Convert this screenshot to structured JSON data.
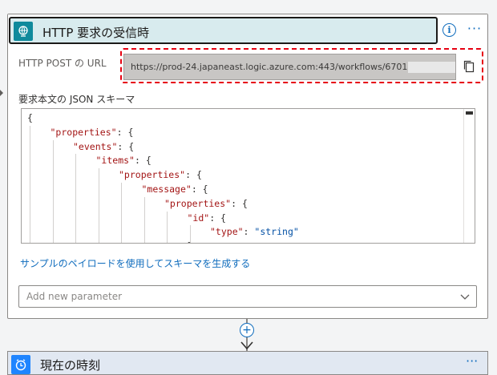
{
  "trigger": {
    "title": "HTTP 要求の受信時",
    "url_label": "HTTP POST の URL",
    "url_value": "https://prod-24.japaneast.logic.azure.com:443/workflows/6701",
    "schema_label": "要求本文の JSON スキーマ",
    "schema_lines": [
      {
        "indent": 0,
        "parts": [
          {
            "t": "{",
            "c": "p"
          }
        ]
      },
      {
        "indent": 1,
        "parts": [
          {
            "t": "\"properties\"",
            "c": "k"
          },
          {
            "t": ": {",
            "c": "p"
          }
        ]
      },
      {
        "indent": 2,
        "parts": [
          {
            "t": "\"events\"",
            "c": "k"
          },
          {
            "t": ": {",
            "c": "p"
          }
        ]
      },
      {
        "indent": 3,
        "parts": [
          {
            "t": "\"items\"",
            "c": "k"
          },
          {
            "t": ": {",
            "c": "p"
          }
        ]
      },
      {
        "indent": 4,
        "parts": [
          {
            "t": "\"properties\"",
            "c": "k"
          },
          {
            "t": ": {",
            "c": "p"
          }
        ]
      },
      {
        "indent": 5,
        "parts": [
          {
            "t": "\"message\"",
            "c": "k"
          },
          {
            "t": ": {",
            "c": "p"
          }
        ]
      },
      {
        "indent": 6,
        "parts": [
          {
            "t": "\"properties\"",
            "c": "k"
          },
          {
            "t": ": {",
            "c": "p"
          }
        ]
      },
      {
        "indent": 7,
        "parts": [
          {
            "t": "\"id\"",
            "c": "k"
          },
          {
            "t": ": {",
            "c": "p"
          }
        ]
      },
      {
        "indent": 8,
        "parts": [
          {
            "t": "\"type\"",
            "c": "k"
          },
          {
            "t": ": ",
            "c": "p"
          },
          {
            "t": "\"string\"",
            "c": "s"
          }
        ]
      },
      {
        "indent": 7,
        "parts": [
          {
            "t": "},",
            "c": "p"
          }
        ]
      }
    ],
    "generate_link": "サンプルのペイロードを使用してスキーマを生成する",
    "add_param_placeholder": "Add new parameter"
  },
  "next_action": {
    "title": "現在の時刻"
  },
  "colors": {
    "accent": "#0f6cbd",
    "highlight": "#e60012",
    "trigger_icon_bg": "#0f8a9c",
    "header_bg": "#d8ebee"
  },
  "icons": {
    "trigger": "http-globe-icon",
    "info": "info-icon",
    "more": "more-options-icon",
    "copy": "copy-icon",
    "add": "add-step-icon",
    "clock": "clock-icon"
  }
}
